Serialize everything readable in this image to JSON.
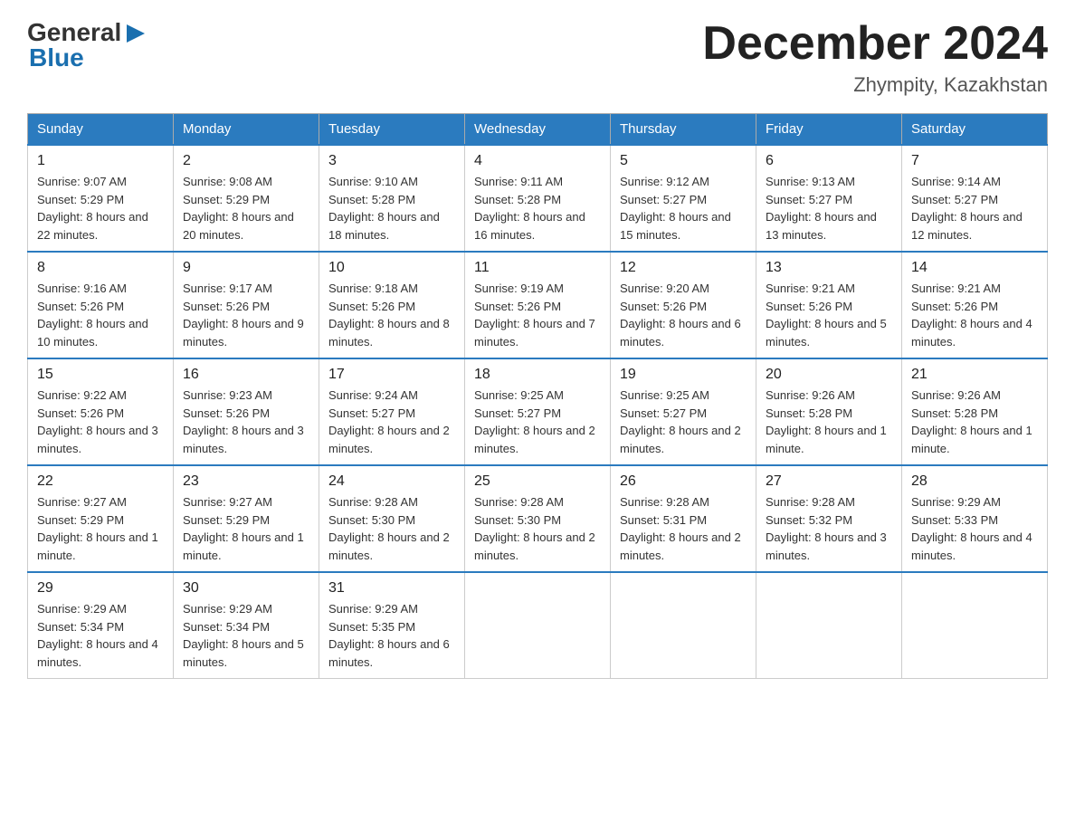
{
  "header": {
    "logo_text1": "General",
    "logo_text2": "Blue",
    "month_title": "December 2024",
    "location": "Zhympity, Kazakhstan"
  },
  "days_of_week": [
    "Sunday",
    "Monday",
    "Tuesday",
    "Wednesday",
    "Thursday",
    "Friday",
    "Saturday"
  ],
  "weeks": [
    [
      {
        "date": "1",
        "sunrise": "Sunrise: 9:07 AM",
        "sunset": "Sunset: 5:29 PM",
        "daylight": "Daylight: 8 hours and 22 minutes."
      },
      {
        "date": "2",
        "sunrise": "Sunrise: 9:08 AM",
        "sunset": "Sunset: 5:29 PM",
        "daylight": "Daylight: 8 hours and 20 minutes."
      },
      {
        "date": "3",
        "sunrise": "Sunrise: 9:10 AM",
        "sunset": "Sunset: 5:28 PM",
        "daylight": "Daylight: 8 hours and 18 minutes."
      },
      {
        "date": "4",
        "sunrise": "Sunrise: 9:11 AM",
        "sunset": "Sunset: 5:28 PM",
        "daylight": "Daylight: 8 hours and 16 minutes."
      },
      {
        "date": "5",
        "sunrise": "Sunrise: 9:12 AM",
        "sunset": "Sunset: 5:27 PM",
        "daylight": "Daylight: 8 hours and 15 minutes."
      },
      {
        "date": "6",
        "sunrise": "Sunrise: 9:13 AM",
        "sunset": "Sunset: 5:27 PM",
        "daylight": "Daylight: 8 hours and 13 minutes."
      },
      {
        "date": "7",
        "sunrise": "Sunrise: 9:14 AM",
        "sunset": "Sunset: 5:27 PM",
        "daylight": "Daylight: 8 hours and 12 minutes."
      }
    ],
    [
      {
        "date": "8",
        "sunrise": "Sunrise: 9:16 AM",
        "sunset": "Sunset: 5:26 PM",
        "daylight": "Daylight: 8 hours and 10 minutes."
      },
      {
        "date": "9",
        "sunrise": "Sunrise: 9:17 AM",
        "sunset": "Sunset: 5:26 PM",
        "daylight": "Daylight: 8 hours and 9 minutes."
      },
      {
        "date": "10",
        "sunrise": "Sunrise: 9:18 AM",
        "sunset": "Sunset: 5:26 PM",
        "daylight": "Daylight: 8 hours and 8 minutes."
      },
      {
        "date": "11",
        "sunrise": "Sunrise: 9:19 AM",
        "sunset": "Sunset: 5:26 PM",
        "daylight": "Daylight: 8 hours and 7 minutes."
      },
      {
        "date": "12",
        "sunrise": "Sunrise: 9:20 AM",
        "sunset": "Sunset: 5:26 PM",
        "daylight": "Daylight: 8 hours and 6 minutes."
      },
      {
        "date": "13",
        "sunrise": "Sunrise: 9:21 AM",
        "sunset": "Sunset: 5:26 PM",
        "daylight": "Daylight: 8 hours and 5 minutes."
      },
      {
        "date": "14",
        "sunrise": "Sunrise: 9:21 AM",
        "sunset": "Sunset: 5:26 PM",
        "daylight": "Daylight: 8 hours and 4 minutes."
      }
    ],
    [
      {
        "date": "15",
        "sunrise": "Sunrise: 9:22 AM",
        "sunset": "Sunset: 5:26 PM",
        "daylight": "Daylight: 8 hours and 3 minutes."
      },
      {
        "date": "16",
        "sunrise": "Sunrise: 9:23 AM",
        "sunset": "Sunset: 5:26 PM",
        "daylight": "Daylight: 8 hours and 3 minutes."
      },
      {
        "date": "17",
        "sunrise": "Sunrise: 9:24 AM",
        "sunset": "Sunset: 5:27 PM",
        "daylight": "Daylight: 8 hours and 2 minutes."
      },
      {
        "date": "18",
        "sunrise": "Sunrise: 9:25 AM",
        "sunset": "Sunset: 5:27 PM",
        "daylight": "Daylight: 8 hours and 2 minutes."
      },
      {
        "date": "19",
        "sunrise": "Sunrise: 9:25 AM",
        "sunset": "Sunset: 5:27 PM",
        "daylight": "Daylight: 8 hours and 2 minutes."
      },
      {
        "date": "20",
        "sunrise": "Sunrise: 9:26 AM",
        "sunset": "Sunset: 5:28 PM",
        "daylight": "Daylight: 8 hours and 1 minute."
      },
      {
        "date": "21",
        "sunrise": "Sunrise: 9:26 AM",
        "sunset": "Sunset: 5:28 PM",
        "daylight": "Daylight: 8 hours and 1 minute."
      }
    ],
    [
      {
        "date": "22",
        "sunrise": "Sunrise: 9:27 AM",
        "sunset": "Sunset: 5:29 PM",
        "daylight": "Daylight: 8 hours and 1 minute."
      },
      {
        "date": "23",
        "sunrise": "Sunrise: 9:27 AM",
        "sunset": "Sunset: 5:29 PM",
        "daylight": "Daylight: 8 hours and 1 minute."
      },
      {
        "date": "24",
        "sunrise": "Sunrise: 9:28 AM",
        "sunset": "Sunset: 5:30 PM",
        "daylight": "Daylight: 8 hours and 2 minutes."
      },
      {
        "date": "25",
        "sunrise": "Sunrise: 9:28 AM",
        "sunset": "Sunset: 5:30 PM",
        "daylight": "Daylight: 8 hours and 2 minutes."
      },
      {
        "date": "26",
        "sunrise": "Sunrise: 9:28 AM",
        "sunset": "Sunset: 5:31 PM",
        "daylight": "Daylight: 8 hours and 2 minutes."
      },
      {
        "date": "27",
        "sunrise": "Sunrise: 9:28 AM",
        "sunset": "Sunset: 5:32 PM",
        "daylight": "Daylight: 8 hours and 3 minutes."
      },
      {
        "date": "28",
        "sunrise": "Sunrise: 9:29 AM",
        "sunset": "Sunset: 5:33 PM",
        "daylight": "Daylight: 8 hours and 4 minutes."
      }
    ],
    [
      {
        "date": "29",
        "sunrise": "Sunrise: 9:29 AM",
        "sunset": "Sunset: 5:34 PM",
        "daylight": "Daylight: 8 hours and 4 minutes."
      },
      {
        "date": "30",
        "sunrise": "Sunrise: 9:29 AM",
        "sunset": "Sunset: 5:34 PM",
        "daylight": "Daylight: 8 hours and 5 minutes."
      },
      {
        "date": "31",
        "sunrise": "Sunrise: 9:29 AM",
        "sunset": "Sunset: 5:35 PM",
        "daylight": "Daylight: 8 hours and 6 minutes."
      },
      null,
      null,
      null,
      null
    ]
  ]
}
